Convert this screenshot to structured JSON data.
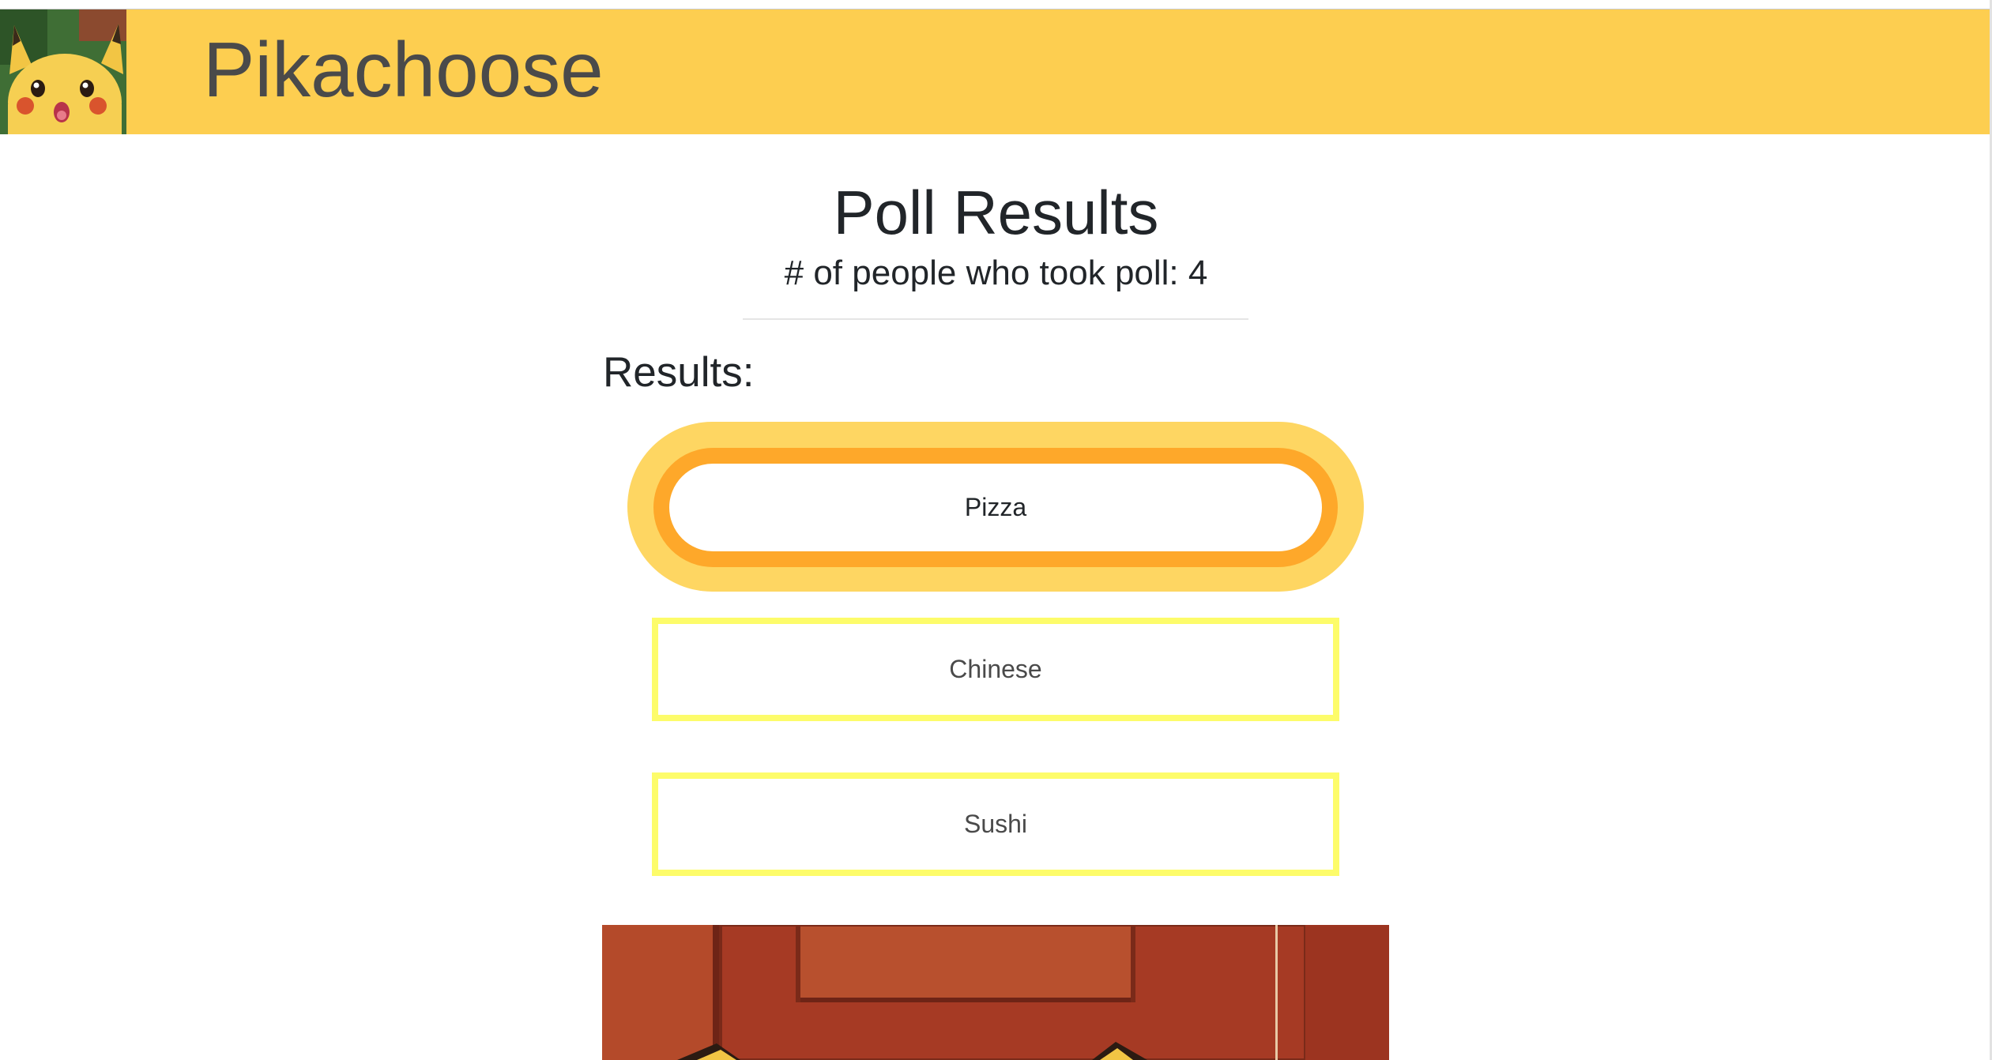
{
  "navbar": {
    "brand": "Pikachoose",
    "logo_icon": "pikachu-logo-icon"
  },
  "poll": {
    "title": "Poll Results",
    "participants_text": "# of people who took poll: 4",
    "results_label": "Results:"
  },
  "results": [
    {
      "label": "Pizza",
      "winner": true
    },
    {
      "label": "Chinese",
      "winner": false
    },
    {
      "label": "Sushi",
      "winner": false
    }
  ],
  "colors": {
    "navbar": "#fdce50",
    "winner_glow": "#fed662",
    "winner_border": "#fea82a",
    "option_border": "#fdfc6a",
    "image_background": "#a63a24"
  }
}
